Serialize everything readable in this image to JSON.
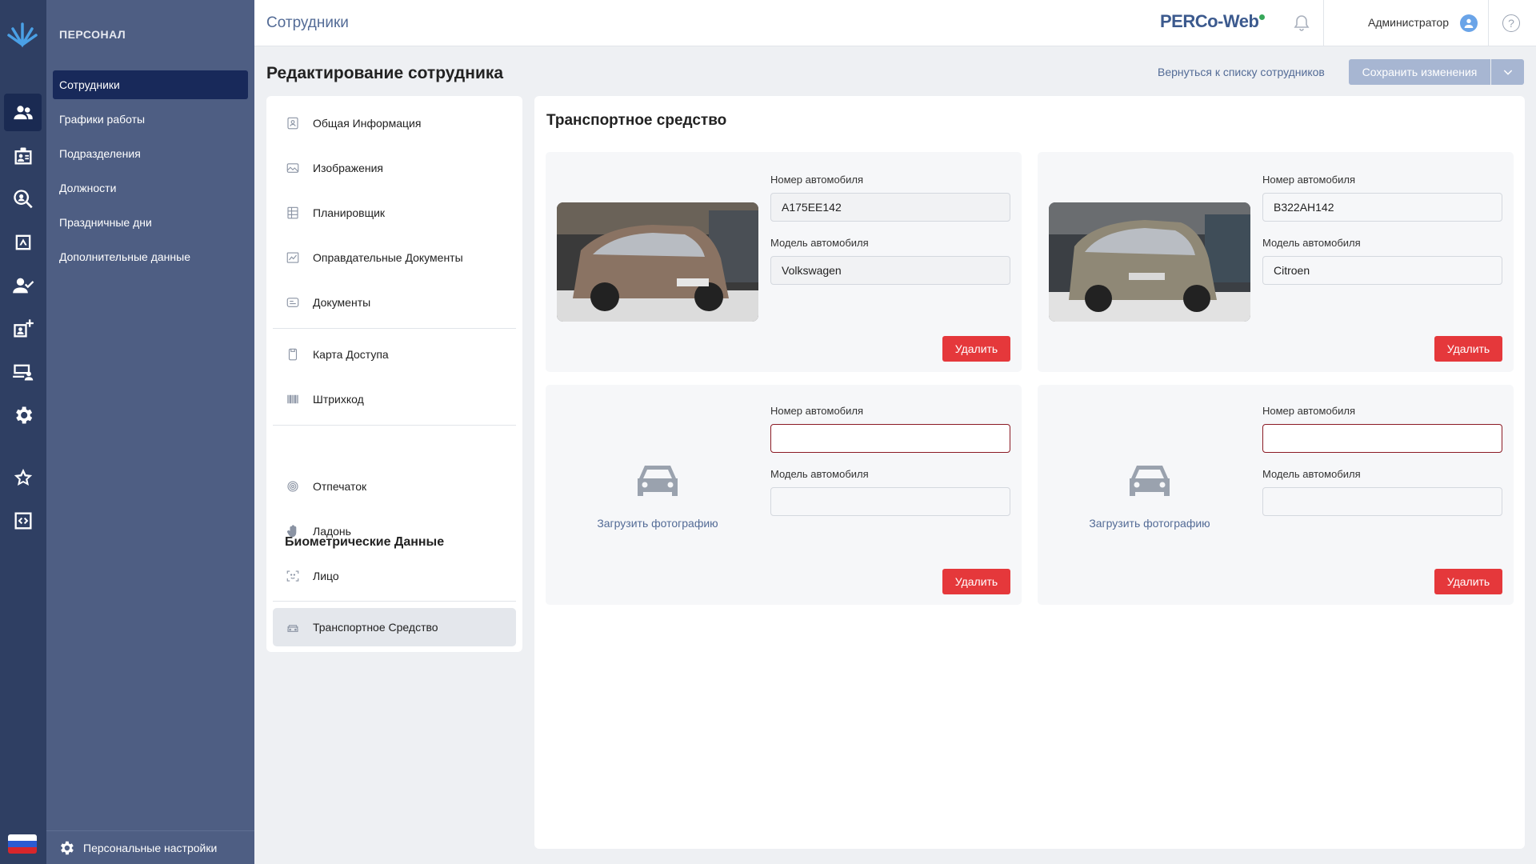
{
  "sidebar": {
    "section_title": "ПЕРСОНАЛ",
    "items": [
      {
        "label": "Сотрудники"
      },
      {
        "label": "Графики работы"
      },
      {
        "label": "Подразделения"
      },
      {
        "label": "Должности"
      },
      {
        "label": "Праздничные дни"
      },
      {
        "label": "Дополнительные данные"
      }
    ],
    "personal_settings": "Персональные настройки"
  },
  "topbar": {
    "title": "Сотрудники",
    "brand": "PERCo-Web",
    "user": "Администратор",
    "help": "?"
  },
  "page": {
    "title": "Редактирование сотрудника",
    "back_link": "Вернуться к списку сотрудников",
    "save": "Сохранить изменения"
  },
  "menu": {
    "items": [
      {
        "label": "Общая Информация",
        "icon": "id-card-icon"
      },
      {
        "label": "Изображения",
        "icon": "image-icon"
      },
      {
        "label": "Планировщик",
        "icon": "calendar-icon"
      },
      {
        "label": "Оправдательные Документы",
        "icon": "chart-doc-icon"
      },
      {
        "label": "Документы",
        "icon": "doc-icon"
      },
      {
        "label": "Карта Доступа",
        "icon": "card-icon"
      },
      {
        "label": "Штрихкод",
        "icon": "barcode-icon"
      }
    ],
    "biometric_heading": "Биометрические Данные",
    "biometric_items": [
      {
        "label": "Отпечаток",
        "icon": "fingerprint-icon"
      },
      {
        "label": "Ладонь",
        "icon": "palm-icon"
      },
      {
        "label": "Лицо",
        "icon": "face-scan-icon"
      }
    ],
    "vehicle_item": {
      "label": "Транспортное Средство",
      "icon": "car-icon"
    }
  },
  "content": {
    "title": "Транспортное средство",
    "plate_label": "Номер автомобиля",
    "model_label": "Модель автомобиля",
    "delete_label": "Удалить",
    "upload_label": "Загрузить фотографию",
    "vehicles": [
      {
        "plate": "А175ЕЕ142",
        "model": "Volkswagen",
        "has_photo": true,
        "photo_color": "#8a7363"
      },
      {
        "plate": "В322АН142",
        "model": "Citroen",
        "has_photo": true,
        "photo_color": "#8f8876"
      },
      {
        "plate": "",
        "model": "",
        "has_photo": false
      },
      {
        "plate": "",
        "model": "",
        "has_photo": false
      }
    ]
  },
  "colors": {
    "rail": "#2f3f63",
    "sidebar": "#4e5e83",
    "active_nav": "#18295a",
    "delete": "#e5383b",
    "save": "#a7b6d2",
    "accent_link": "#536b96"
  }
}
